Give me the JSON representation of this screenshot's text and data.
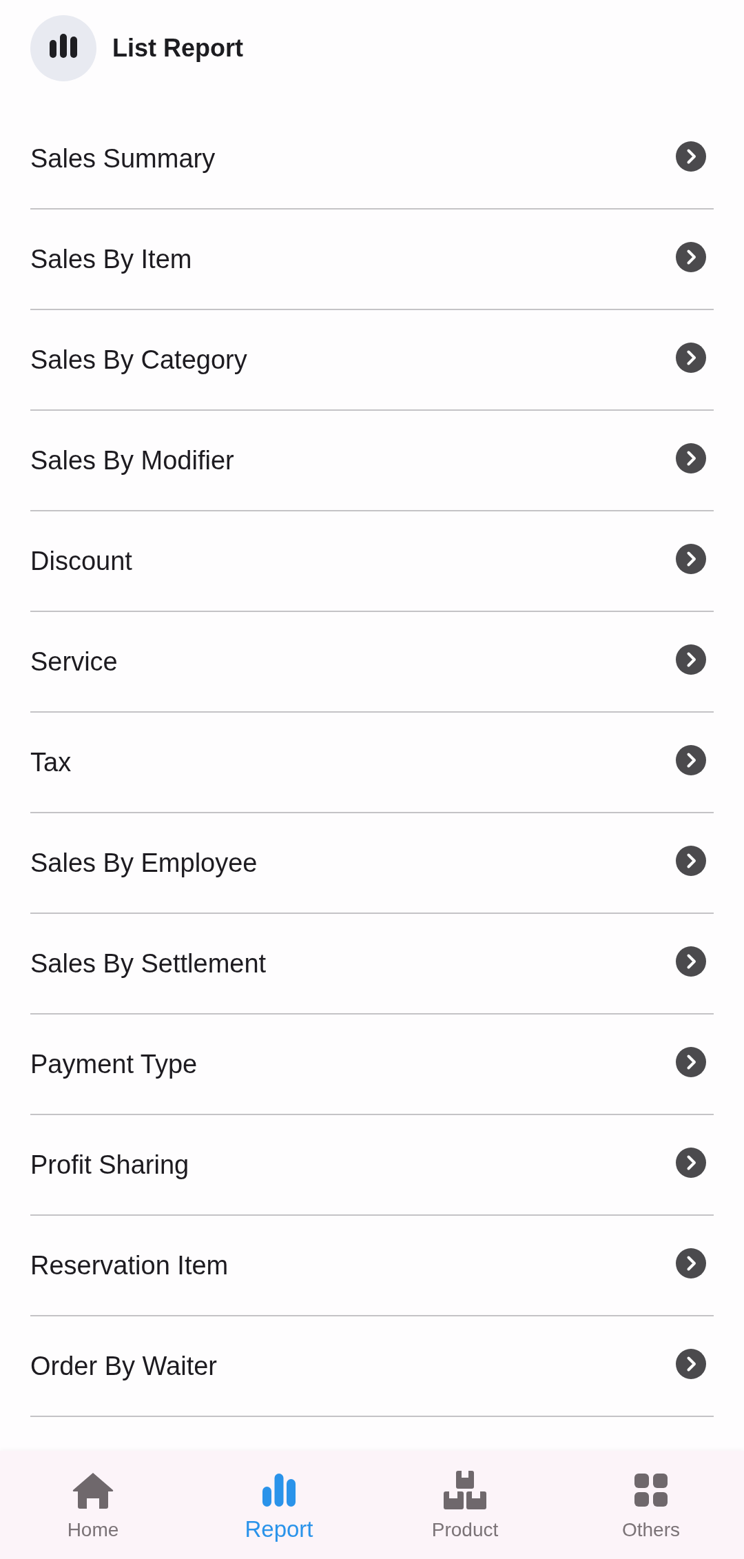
{
  "header": {
    "title": "List Report"
  },
  "reports": [
    "Sales Summary",
    "Sales By Item",
    "Sales By Category",
    "Sales By Modifier",
    "Discount",
    "Service",
    "Tax",
    "Sales By Employee",
    "Sales By Settlement",
    "Payment Type",
    "Profit Sharing",
    "Reservation Item",
    "Order By Waiter"
  ],
  "bottom_nav": {
    "items": [
      {
        "label": "Home",
        "selected": false
      },
      {
        "label": "Report",
        "selected": true
      },
      {
        "label": "Product",
        "selected": false
      },
      {
        "label": "Others",
        "selected": false
      }
    ]
  }
}
